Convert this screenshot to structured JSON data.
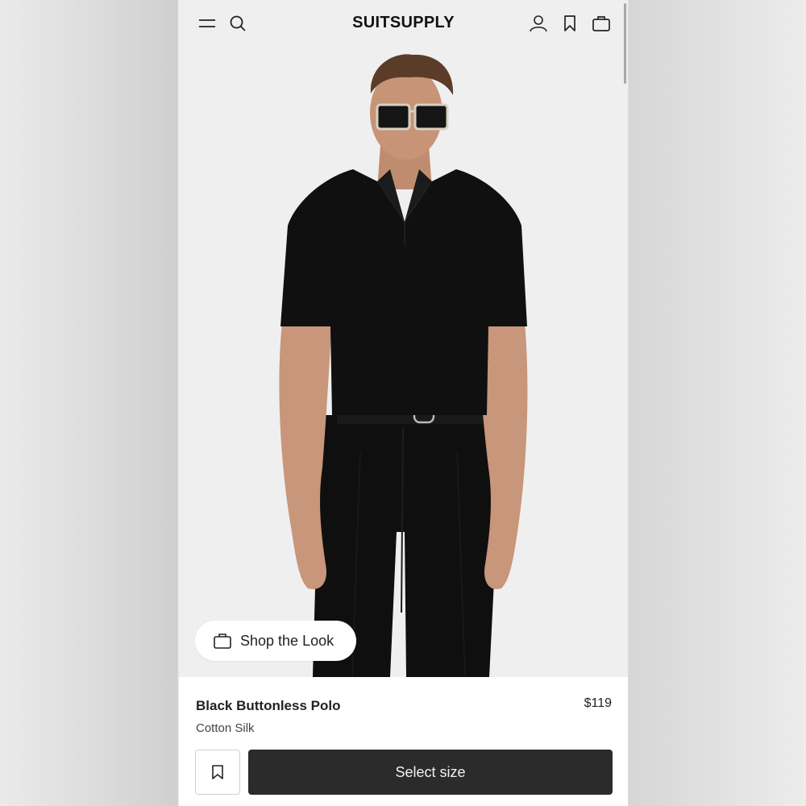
{
  "header": {
    "brand": "SUITSUPPLY",
    "icons": [
      "menu-icon",
      "search-icon",
      "account-icon",
      "wishlist-icon",
      "bag-icon"
    ]
  },
  "hero": {
    "shop_the_look_label": "Shop the Look"
  },
  "product": {
    "name": "Black Buttonless Polo",
    "price": "$119",
    "material": "Cotton Silk",
    "select_size_label": "Select size"
  },
  "colors": {
    "accent": "#2b2b2b",
    "background": "#efefef",
    "text": "#222222"
  }
}
